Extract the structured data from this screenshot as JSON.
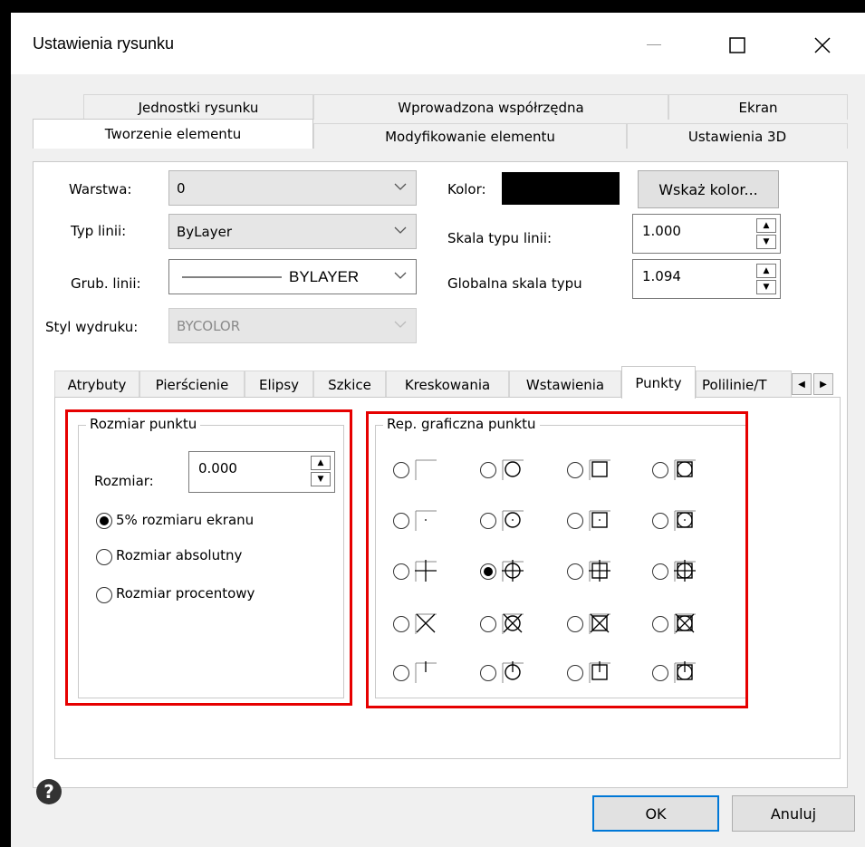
{
  "window": {
    "title": "Ustawienia rysunku"
  },
  "tabs_row1": [
    "Jednostki rysunku",
    "Wprowadzona współrzędna",
    "Ekran"
  ],
  "tabs_row2": [
    "Tworzenie elementu",
    "Modyfikowanie elementu",
    "Ustawienia 3D"
  ],
  "active_tab": "Tworzenie elementu",
  "form": {
    "layer_label": "Warstwa:",
    "layer_value": "0",
    "linetype_label": "Typ linii:",
    "linetype_value": "ByLayer",
    "lineweight_label": "Grub. linii:",
    "lineweight_value": "BYLAYER",
    "plotstyle_label": "Styl wydruku:",
    "plotstyle_value": "BYCOLOR",
    "color_label": "Kolor:",
    "color_value": "#000000",
    "choose_color_button": "Wskaż kolor...",
    "linetype_scale_label": "Skala typu linii:",
    "linetype_scale_value": "1.000",
    "global_scale_label": "Globalna skala typu",
    "global_scale_value": "1.094"
  },
  "subtabs": [
    "Atrybuty",
    "Pierścienie",
    "Elipsy",
    "Szkice",
    "Kreskowania",
    "Wstawienia",
    "Punkty",
    "Polilinie/T"
  ],
  "active_subtab": "Punkty",
  "point_size": {
    "group_title": "Rozmiar punktu",
    "size_label": "Rozmiar:",
    "size_value": "0.000",
    "options": [
      "5% rozmiaru ekranu",
      "Rozmiar absolutny",
      "Rozmiar procentowy"
    ],
    "selected_option": 0
  },
  "point_display": {
    "group_title": "Rep. graficzna punktu",
    "selected": {
      "row": 2,
      "col": 1
    }
  },
  "buttons": {
    "ok": "OK",
    "cancel": "Anuluj"
  },
  "colors": {
    "highlight_border": "#e60000",
    "focus_border": "#0078d7"
  }
}
